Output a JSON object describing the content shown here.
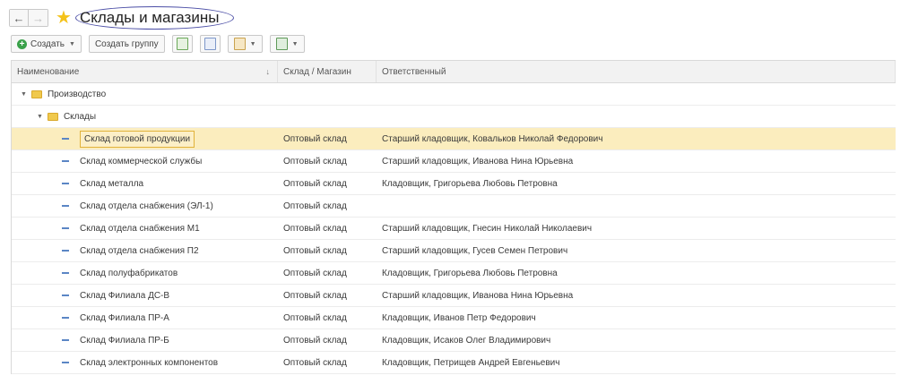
{
  "window": {
    "title": "Склады и магазины"
  },
  "toolbar": {
    "create_label": "Создать",
    "create_group_label": "Создать группу"
  },
  "table": {
    "headers": [
      "Наименование",
      "Склад / Магазин",
      "Ответственный"
    ],
    "groups": [
      {
        "label": "Производство"
      },
      {
        "label": "Склады"
      }
    ],
    "rows": [
      {
        "name": "Склад готовой продукции",
        "type": "Оптовый склад",
        "responsible": "Старший кладовщик, Ковальков Николай Федорович"
      },
      {
        "name": "Склад коммерческой службы",
        "type": "Оптовый склад",
        "responsible": "Старший кладовщик, Иванова Нина Юрьевна"
      },
      {
        "name": "Склад металла",
        "type": "Оптовый склад",
        "responsible": "Кладовщик, Григорьева Любовь Петровна"
      },
      {
        "name": "Склад отдела снабжения (ЭЛ-1)",
        "type": "Оптовый склад",
        "responsible": ""
      },
      {
        "name": "Склад отдела снабжения М1",
        "type": "Оптовый склад",
        "responsible": "Старший кладовщик, Гнесин Николай Николаевич"
      },
      {
        "name": "Склад отдела снабжения П2",
        "type": "Оптовый склад",
        "responsible": "Старший кладовщик, Гусев Семен Петрович"
      },
      {
        "name": "Склад полуфабрикатов",
        "type": "Оптовый склад",
        "responsible": "Кладовщик, Григорьева Любовь Петровна"
      },
      {
        "name": "Склад Филиала ДС-В",
        "type": "Оптовый склад",
        "responsible": "Старший кладовщик, Иванова Нина Юрьевна"
      },
      {
        "name": "Склад Филиала ПР-А",
        "type": "Оптовый склад",
        "responsible": "Кладовщик, Иванов Петр Федорович"
      },
      {
        "name": "Склад Филиала ПР-Б",
        "type": "Оптовый склад",
        "responsible": "Кладовщик, Исаков Олег Владимирович"
      },
      {
        "name": "Склад электронных компонентов",
        "type": "Оптовый склад",
        "responsible": "Кладовщик, Петрищев Андрей Евгеньевич"
      }
    ]
  },
  "icons": {
    "back": "arrow-left-icon",
    "forward": "arrow-right-icon",
    "favorite": "star-icon",
    "sort": "sort-arrow-icon",
    "folder": "folder-icon",
    "item": "item-dash-icon"
  },
  "colors": {
    "selected_row": "#fbedbe",
    "star": "#f4c21a",
    "create_plus": "#3aa14a",
    "folder": "#f0c94d",
    "item_dash": "#5b86c5"
  }
}
